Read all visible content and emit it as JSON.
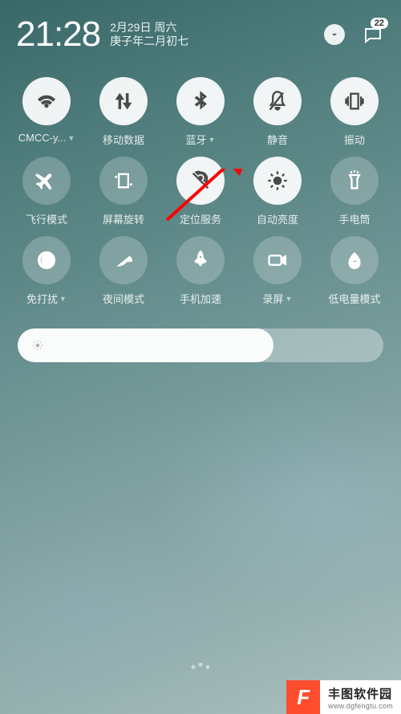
{
  "status": {
    "time": "21:28",
    "date_line1": "2月29日 周六",
    "date_line2": "庚子年二月初七",
    "badge_count": "22"
  },
  "tiles": [
    {
      "label": "CMCC-y...",
      "icon": "wifi",
      "active": true,
      "dropdown": true
    },
    {
      "label": "移动数据",
      "icon": "data",
      "active": true,
      "dropdown": false
    },
    {
      "label": "蓝牙",
      "icon": "bluetooth",
      "active": true,
      "dropdown": true
    },
    {
      "label": "静音",
      "icon": "mute",
      "active": true,
      "dropdown": false
    },
    {
      "label": "振动",
      "icon": "vibrate",
      "active": true,
      "dropdown": false
    },
    {
      "label": "飞行模式",
      "icon": "airplane",
      "active": false,
      "dropdown": false
    },
    {
      "label": "屏幕旋转",
      "icon": "rotation",
      "active": false,
      "dropdown": false
    },
    {
      "label": "定位服务",
      "icon": "location",
      "active": true,
      "dropdown": false
    },
    {
      "label": "自动亮度",
      "icon": "brightness-auto",
      "active": true,
      "dropdown": false
    },
    {
      "label": "手电筒",
      "icon": "flashlight",
      "active": false,
      "dropdown": false
    },
    {
      "label": "免打扰",
      "icon": "dnd",
      "active": false,
      "dropdown": true
    },
    {
      "label": "夜间模式",
      "icon": "night",
      "active": false,
      "dropdown": false
    },
    {
      "label": "手机加速",
      "icon": "boost",
      "active": false,
      "dropdown": false
    },
    {
      "label": "录屏",
      "icon": "record",
      "active": false,
      "dropdown": true
    },
    {
      "label": "低电量模式",
      "icon": "battery-saver",
      "active": false,
      "dropdown": false
    }
  ],
  "slider": {
    "percent": 70
  },
  "watermark": {
    "flag": "F",
    "line1": "丰图软件园",
    "line2": "www.dgfengtu.com"
  },
  "annotation": {
    "target": "mute-tile"
  }
}
